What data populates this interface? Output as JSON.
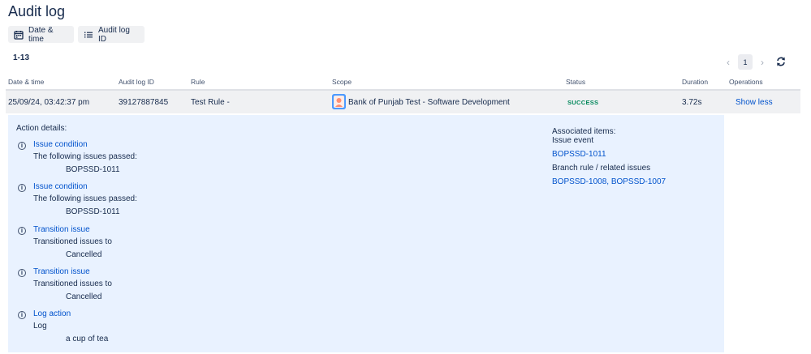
{
  "page_title": "Audit log",
  "filters": [
    {
      "label": "Date & time",
      "icon": "calendar-icon"
    },
    {
      "label": "Audit log ID",
      "icon": "list-icon"
    }
  ],
  "range_label": "1-13",
  "pagination": {
    "current_page": "1",
    "prev_icon": "chevron-left-icon",
    "next_icon": "chevron-right-icon"
  },
  "table": {
    "headers": [
      "Date & time",
      "Audit log ID",
      "Rule",
      "Scope",
      "Status",
      "Duration",
      "Operations"
    ],
    "row": {
      "date_time": "25/09/24, 03:42:37 pm",
      "audit_log_id": "39127887845",
      "rule": "Test Rule -",
      "scope": "Bank of Punjab Test - Software Development",
      "status": "SUCCESS",
      "duration": "3.72s",
      "operation": "Show less"
    }
  },
  "details": {
    "title": "Action details:",
    "actions": [
      {
        "name": "Issue condition",
        "description": "The following issues passed:",
        "value": "BOPSSD-1011"
      },
      {
        "name": "Issue condition",
        "description": "The following issues passed:",
        "value": "BOPSSD-1011"
      },
      {
        "name": "Transition issue",
        "description": "Transitioned issues to",
        "value": "Cancelled"
      },
      {
        "name": "Transition issue",
        "description": "Transitioned issues to",
        "value": "Cancelled"
      },
      {
        "name": "Log action",
        "description": "Log",
        "value": "a cup of tea"
      }
    ],
    "associated": {
      "title": "Associated items:",
      "event_label": "Issue event",
      "event_link": "BOPSSD-1011",
      "branch_label": "Branch rule / related issues",
      "branch_links": "BOPSSD-1008, BOPSSD-1007"
    }
  },
  "colors": {
    "link": "#0052cc",
    "success": "#00875a",
    "panel": "#e9f2ff",
    "row": "#f0f1f3"
  }
}
